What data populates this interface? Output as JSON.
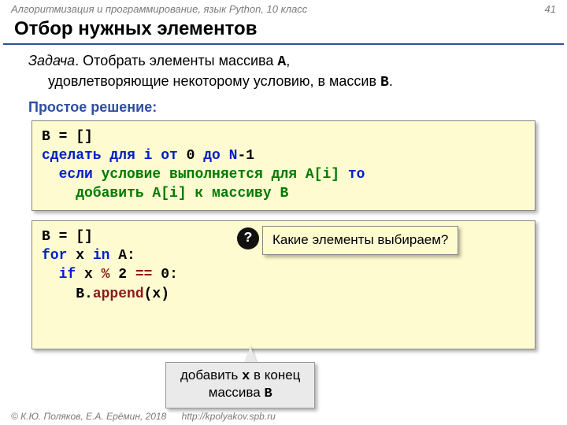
{
  "header": {
    "course": "Алгоритмизация и программирование, язык Python, 10 класс",
    "page": "41"
  },
  "title": "Отбор нужных элементов",
  "task": {
    "label": "Задача",
    "line1a": ". Отобрать элементы массива ",
    "arrA": "A",
    "line1b": ",",
    "line2a": "удовлетворяющие некоторому условию, в массив ",
    "arrB": "B",
    "line2b": "."
  },
  "subhead": "Простое решение:",
  "pseudo": {
    "l1a": "B",
    "l1b": " = []",
    "l2a": "сделать для i от ",
    "l2b": "0",
    "l2c": " до N",
    "l2d": "-",
    "l2e": "1",
    "l3a": "  если ",
    "l3b": "условие выполняется для A[i]",
    "l3c": " то",
    "l4a": "    добавить A[i] к массиву B"
  },
  "python": {
    "l1a": "B",
    "l1b": " = []",
    "l2a": "for",
    "l2b": " x ",
    "l2c": "in",
    "l2d": " A:",
    "l3a": "  if",
    "l3b": " x",
    "l3c": " % ",
    "l3d": "2",
    "l3e": " == ",
    "l3f": "0",
    "l3g": ":",
    "l4a": "    B.",
    "l4b": "append",
    "l4c": "(x)"
  },
  "callout": {
    "q": "?",
    "text": "Какие элементы выбираем?"
  },
  "bottom": {
    "t1": "добавить ",
    "x": "x",
    "t2": " в конец",
    "t3": "массива ",
    "b": "B"
  },
  "footer": {
    "copy": "© К.Ю. Поляков, Е.А. Ерёмин, 2018",
    "url": "http://kpolyakov.spb.ru"
  }
}
